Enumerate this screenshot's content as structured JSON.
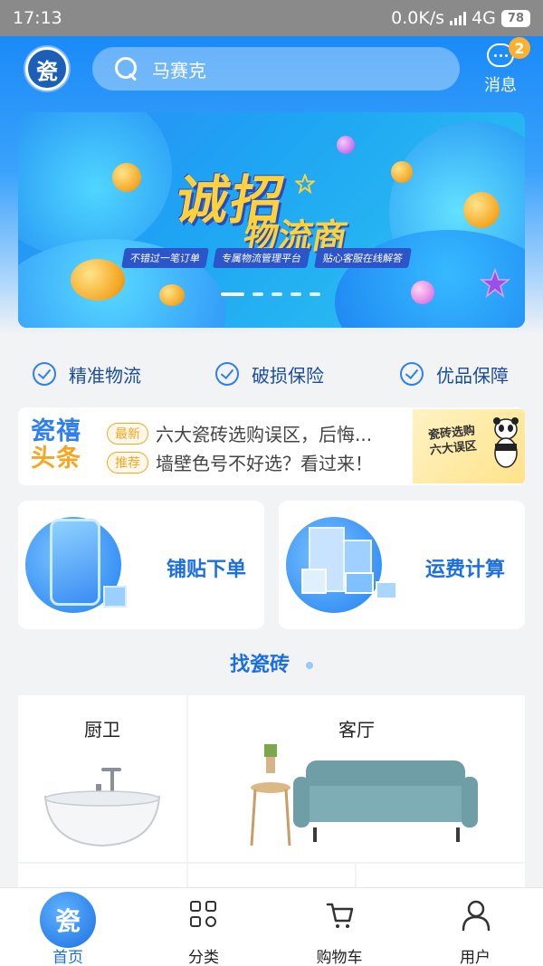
{
  "status_bar": {
    "time": "17:13",
    "network_speed": "0.0K/s",
    "network_type": "4G",
    "battery": "78"
  },
  "header": {
    "logo_char": "瓷",
    "search_placeholder": "马赛克",
    "message_label": "消息",
    "message_badge": "2"
  },
  "banner": {
    "title": "诚招",
    "subtitle": "物流商",
    "tags": [
      "不错过一笔订单",
      "专属物流管理平台",
      "贴心客服在线解答"
    ],
    "slide_count": 5,
    "active_slide": 0
  },
  "features": [
    "精准物流",
    "破损保险",
    "优品保障"
  ],
  "headlines": {
    "logo_line1": "瓷禧",
    "logo_line2": "头条",
    "items": [
      {
        "tag": "最新",
        "text": "六大瓷砖选购误区，后悔..."
      },
      {
        "tag": "推荐",
        "text": "墙壁色号不好选？看过来！"
      }
    ],
    "thumb_text": "瓷砖选购\n六大误区"
  },
  "services": [
    {
      "label": "铺贴下单"
    },
    {
      "label": "运费计算"
    }
  ],
  "section_title": "找瓷砖",
  "categories": [
    {
      "name": "厨卫"
    },
    {
      "name": "客厅"
    }
  ],
  "tabbar": [
    {
      "label": "首页",
      "icon": "home-icon",
      "active": true
    },
    {
      "label": "分类",
      "icon": "category-icon",
      "active": false
    },
    {
      "label": "购物车",
      "icon": "cart-icon",
      "active": false
    },
    {
      "label": "用户",
      "icon": "user-icon",
      "active": false
    }
  ],
  "colors": {
    "accent": "#1c6fe0",
    "badge": "#ffb02e",
    "banner_yellow": "#ffd23a"
  }
}
